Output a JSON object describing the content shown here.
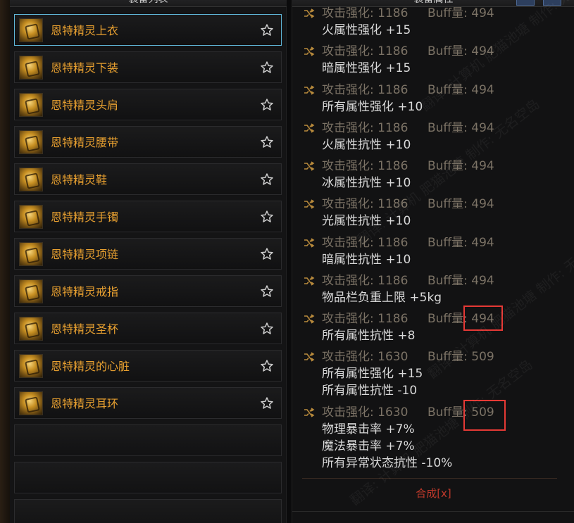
{
  "left_panel": {
    "header": "装备列表",
    "items": [
      {
        "label": "恩特精灵上衣"
      },
      {
        "label": "恩特精灵下装"
      },
      {
        "label": "恩特精灵头肩"
      },
      {
        "label": "恩特精灵腰带"
      },
      {
        "label": "恩特精灵鞋"
      },
      {
        "label": "恩特精灵手镯"
      },
      {
        "label": "恩特精灵项链"
      },
      {
        "label": "恩特精灵戒指"
      },
      {
        "label": "恩特精灵圣杯"
      },
      {
        "label": "恩特精灵的心脏"
      },
      {
        "label": "恩特精灵耳环"
      }
    ]
  },
  "right_panel": {
    "header": "装备属性",
    "stats": [
      {
        "atk": "攻击强化: 1186",
        "buff": "Buff量: 494"
      },
      {
        "atk": "攻击强化: 1186",
        "buff": "Buff量: 494"
      },
      {
        "atk": "攻击强化: 1186",
        "buff": "Buff量: 494"
      },
      {
        "atk": "攻击强化: 1186",
        "buff": "Buff量: 494"
      },
      {
        "atk": "攻击强化: 1186",
        "buff": "Buff量: 494"
      },
      {
        "atk": "攻击强化: 1186",
        "buff": "Buff量: 494"
      },
      {
        "atk": "攻击强化: 1186",
        "buff": "Buff量: 494"
      },
      {
        "atk": "攻击强化: 1186",
        "buff": "Buff量: 494"
      },
      {
        "atk": "攻击强化: 1186",
        "buff": "Buff量: 494"
      },
      {
        "atk": "攻击强化: 1630",
        "buff": "Buff量: 509"
      },
      {
        "atk": "攻击强化: 1630",
        "buff": "Buff量: 509"
      }
    ],
    "effects": [
      "火属性强化 +15",
      "暗属性强化 +15",
      "所有属性强化 +10",
      "火属性抗性 +10",
      "冰属性抗性 +10",
      "光属性抗性 +10",
      "暗属性抗性 +10",
      "物品栏负重上限 +5kg",
      "所有属性抗性 +8",
      "所有属性强化 +15",
      "所有属性抗性 -10",
      "物理暴击率 +7%",
      "魔法暴击率 +7%",
      "所有异常状态抗性 -10%"
    ],
    "merge_label": "合成[x]"
  },
  "colors": {
    "item_label": "#e8a030",
    "selected_border": "#5fb6d8",
    "stat_text": "#7b7265",
    "effect_text": "#d9d9d9",
    "merge_link": "#c0392b",
    "highlight_box": "#e53935"
  },
  "icons": {
    "favorite": "star-outline-icon",
    "reroll": "shuffle-icon"
  },
  "watermark": "翻译: 计算机 肥猫池塘 制作: 无名空岛"
}
